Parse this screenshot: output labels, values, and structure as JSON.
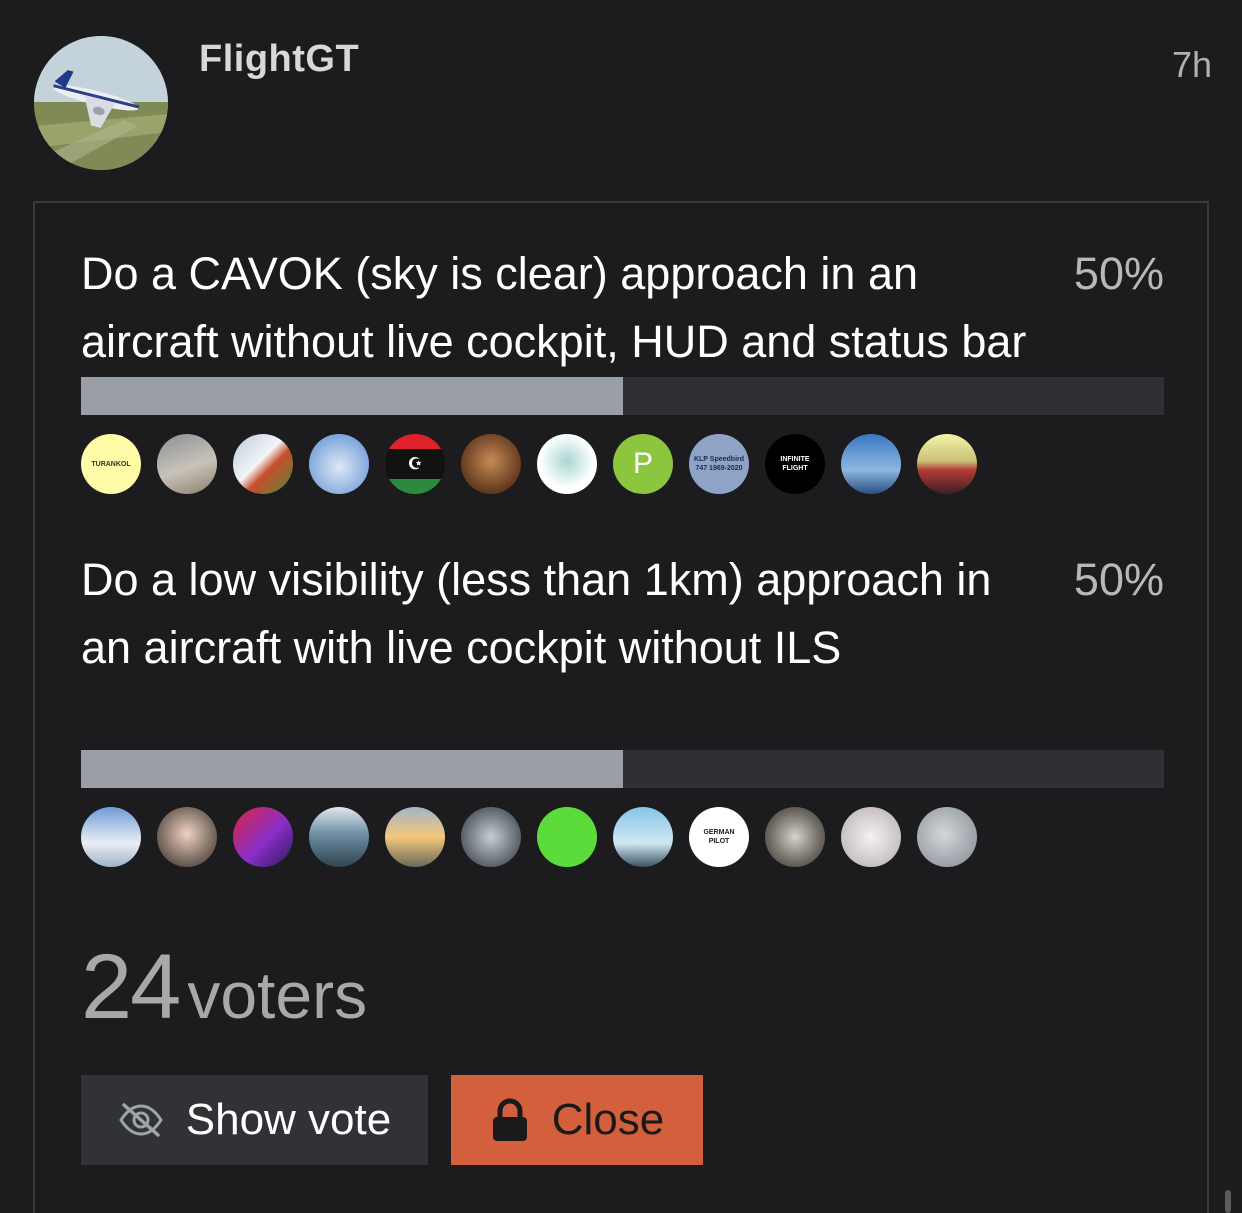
{
  "post": {
    "author": "FlightGT",
    "time": "7h"
  },
  "poll": {
    "options": [
      {
        "text": "Do a CAVOK (sky is clear) approach in an aircraft without live cockpit, HUD and status bar",
        "percent_label": "50%",
        "percent": 50,
        "voters": [
          {
            "kind": "text",
            "label": "TURANKOL",
            "bg": "#fffca8",
            "fg": "#333333"
          },
          {
            "kind": "photo",
            "bg": "linear-gradient(160deg,#8a8f95,#c8c3b8 55%,#8b7e6c)"
          },
          {
            "kind": "photo",
            "bg": "linear-gradient(135deg,#b9cbdc 0%,#f2f4f6 45%,#c94d2c 60%,#4a8a3a 100%)"
          },
          {
            "kind": "photo",
            "bg": "radial-gradient(circle at 50% 55%,#dfe7f5,#7fa8dc 70%)"
          },
          {
            "kind": "flag",
            "bg": "linear-gradient(180deg,#e0202a 0 25%,#111 25% 75%,#2a8a3e 75%)"
          },
          {
            "kind": "photo",
            "bg": "radial-gradient(circle at 50% 45%,#c58b55,#6a3f22 65%,#2b1a10)"
          },
          {
            "kind": "photo",
            "bg": "radial-gradient(circle at 50% 45%,#a8d6d2,#ffffff 60%)"
          },
          {
            "kind": "letter",
            "label": "P",
            "bg": "#8cc63f",
            "fg": "#ffffff"
          },
          {
            "kind": "text",
            "label": "KLP Speedbird 747 1969-2020",
            "bg": "#8ea3c6",
            "fg": "#1c2a52"
          },
          {
            "kind": "text",
            "label": "INFINITE FLIGHT",
            "bg": "#000000",
            "fg": "#ffffff"
          },
          {
            "kind": "photo",
            "bg": "linear-gradient(180deg,#3a78c2,#8db6e0 60%,#2a4f80)"
          },
          {
            "kind": "photo",
            "bg": "linear-gradient(180deg,#f6f3a6 0%,#c9c27a 45%,#b43b35 60%,#3c1f24 100%)"
          }
        ]
      },
      {
        "text": "Do a low visibility (less than 1km) approach in an aircraft with live cockpit without ILS",
        "percent_label": "50%",
        "percent": 50,
        "voters": [
          {
            "kind": "photo",
            "bg": "linear-gradient(180deg,#6f9bd6,#e9eef4 60%,#9eb2c8)"
          },
          {
            "kind": "photo",
            "bg": "radial-gradient(circle at 50% 45%,#f0d2c2,#7a6a60 60%,#2a2a2a)"
          },
          {
            "kind": "photo",
            "bg": "linear-gradient(135deg,#d7263d,#8b2fc9 55%,#2a1a5e)"
          },
          {
            "kind": "photo",
            "bg": "linear-gradient(180deg,#dfe7ee,#6f8fa4 45%,#2f4450)"
          },
          {
            "kind": "photo",
            "bg": "linear-gradient(180deg,#a3b4c6,#f3c77a 50%,#6b6a5a)"
          },
          {
            "kind": "photo",
            "bg": "radial-gradient(circle at 50% 50%,#c7cdd4,#5a6068 70%)"
          },
          {
            "kind": "photo",
            "bg": "#5bdc3a"
          },
          {
            "kind": "photo",
            "bg": "linear-gradient(180deg,#86c4e6,#cfe6f2 60%,#3b5364)"
          },
          {
            "kind": "text",
            "label": "GERMAN PILOT",
            "bg": "#ffffff",
            "fg": "#1a1a1a"
          },
          {
            "kind": "photo",
            "bg": "radial-gradient(circle at 50% 50%,#d6d2cc,#6d6862 60%,#3a3632)"
          },
          {
            "kind": "photo",
            "bg": "radial-gradient(circle at 50% 50%,#f4f1f0,#c7c2c1 70%)"
          },
          {
            "kind": "photo",
            "bg": "radial-gradient(circle at 45% 45%,#d4d6da,#9aa0a6 70%)"
          }
        ]
      }
    ],
    "voter_count": "24",
    "voter_label": "voters"
  },
  "buttons": {
    "show_vote": "Show vote",
    "close": "Close"
  },
  "colors": {
    "background": "#1c1c1e",
    "bar_fill": "#9a9ea5",
    "bar_track": "#303034",
    "close_button": "#d35f3c",
    "show_button": "#303236"
  },
  "icons": {
    "show_vote": "eye-slash-icon",
    "close": "lock-icon"
  }
}
